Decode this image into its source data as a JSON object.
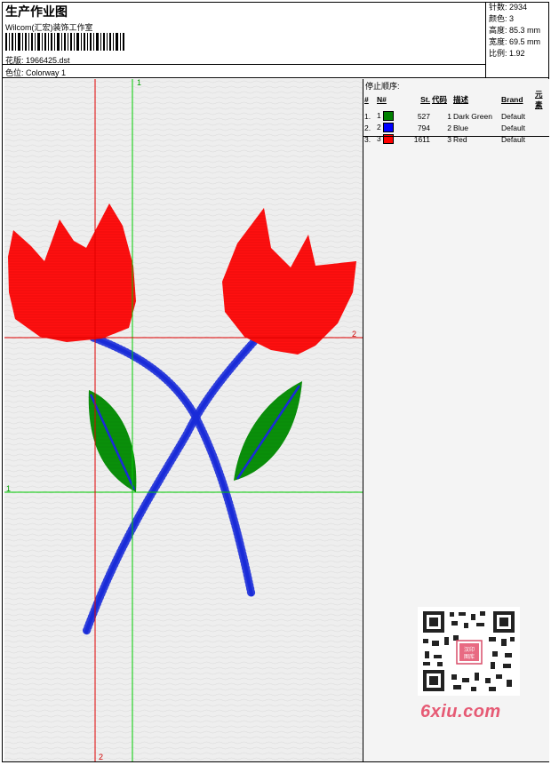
{
  "header": {
    "title": "生产作业图",
    "company": "Wilcom(汇宏)装饰工作室",
    "design_label": "花版: 1966425.dst",
    "color_label": "色位: Colorway 1"
  },
  "stats": [
    {
      "text": "针数: 2934"
    },
    {
      "text": "颜色: 3"
    },
    {
      "text": "高度: 85.3 mm"
    },
    {
      "text": "宽度: 69.5 mm"
    },
    {
      "text": "比例: 1.92"
    }
  ],
  "stop_panel": {
    "title": "停止顺序:",
    "columns": [
      "#",
      "N#",
      "St.",
      "代码",
      "描述",
      "Brand",
      "元素"
    ],
    "rows": [
      {
        "idx": "1.",
        "n": "1",
        "st": "527",
        "code": "1",
        "desc": "Dark Green",
        "brand": "Default",
        "color": "#008000"
      },
      {
        "idx": "2.",
        "n": "2",
        "st": "794",
        "code": "2",
        "desc": "Blue",
        "brand": "Default",
        "color": "#0000ff"
      },
      {
        "idx": "3.",
        "n": "3",
        "st": "1611",
        "code": "3",
        "desc": "Red",
        "brand": "Default",
        "color": "#ff0000"
      }
    ]
  },
  "axis_labels": {
    "green_vertical_top": "1",
    "red_horizontal_right": "2",
    "green_horizontal_left": "1",
    "red_vertical_bottom": "2"
  },
  "watermark": {
    "logo_text": "6xiu.com",
    "seal_text": "汉印图库"
  },
  "colors": {
    "red": "#ff0000",
    "green": "#008000",
    "blue": "#1a2bd8",
    "guide_red": "#e00000",
    "guide_green": "#00cc00",
    "logo": "#e65a74"
  }
}
